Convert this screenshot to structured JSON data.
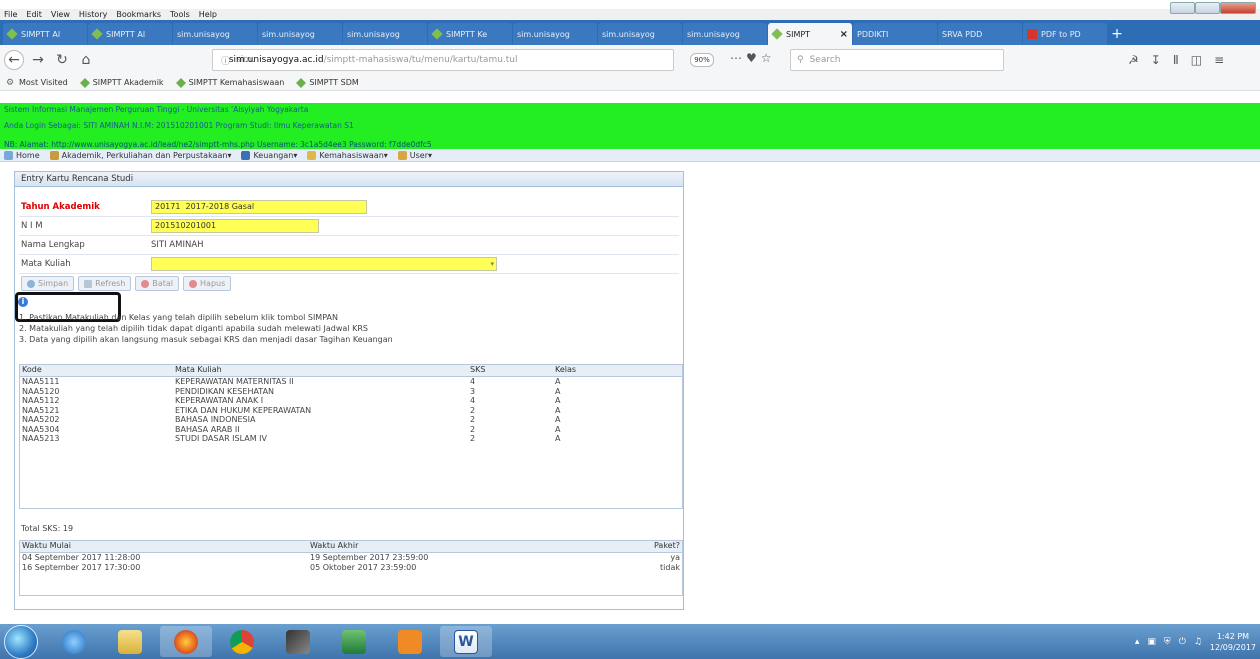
{
  "menubar": [
    "File",
    "Edit",
    "View",
    "History",
    "Bookmarks",
    "Tools",
    "Help"
  ],
  "tabs": [
    {
      "label": "SIMPTT Al",
      "icon": "diamond-icon",
      "active": false
    },
    {
      "label": "SIMPTT Al",
      "icon": "diamond-icon",
      "active": false
    },
    {
      "label": "sim.unisayog",
      "icon": "",
      "active": false
    },
    {
      "label": "sim.unisayog",
      "icon": "",
      "active": false
    },
    {
      "label": "sim.unisayog",
      "icon": "",
      "active": false
    },
    {
      "label": "SIMPTT Ke",
      "icon": "diamond-icon",
      "active": false
    },
    {
      "label": "sim.unisayog",
      "icon": "",
      "active": false
    },
    {
      "label": "sim.unisayog",
      "icon": "",
      "active": false
    },
    {
      "label": "sim.unisayog",
      "icon": "",
      "active": false
    },
    {
      "label": "SIMPT",
      "icon": "diamond-icon",
      "active": true
    },
    {
      "label": "PDDIKTI",
      "icon": "",
      "active": false
    },
    {
      "label": "SRVA PDD",
      "icon": "",
      "active": false
    },
    {
      "label": "PDF to PD",
      "icon": "pdf-icon",
      "active": false
    }
  ],
  "nav": {
    "url_domain": "sim.unisayogya.ac.id",
    "url_rest": "/simptt-mahasiswa/tu/menu/kartu/tamu.tul",
    "url_prefix": "sim.",
    "zoom": "90%",
    "search_placeholder": "Search"
  },
  "bookmarks": [
    {
      "label": "Most Visited"
    },
    {
      "label": "SIMPTT Akademik"
    },
    {
      "label": "SIMPTT Kemahasiswaan"
    },
    {
      "label": "SIMPTT SDM"
    }
  ],
  "green_header": {
    "line1": "Sistem Informasi Manajemen Perguruan Tinggi - Universitas 'Aisyiyah Yogyakarta",
    "line2": "Anda Login Sebagai: SITI AMINAH   N.I.M: 201510201001   Program Studi: Ilmu Keperawatan S1",
    "line3": "NB:   Alamat: http://www.unisayogya.ac.id/lead/ne2/simptt-mhs.php    Username: 3c1a5d4ee3   Password: f7dde0dfc5"
  },
  "app_menu": [
    {
      "label": "Home"
    },
    {
      "label": "Akademik, Perkuliahan dan Perpustakaan"
    },
    {
      "label": "Keuangan"
    },
    {
      "label": "Kemahasiswaan"
    },
    {
      "label": "User"
    }
  ],
  "panel": {
    "title": "Entry Kartu Rencana Studi",
    "tahun_label": "Tahun Akademik",
    "tahun_code": "20171",
    "tahun_name": "2017-2018 Gasal",
    "nim_label": "N I M",
    "nim_value": "201510201001",
    "nama_label": "Nama Lengkap",
    "nama_value": "SITI AMINAH",
    "matkul_label": "Mata Kuliah",
    "matkul_value": ""
  },
  "buttons": {
    "simpan": "Simpan",
    "refresh": "Refresh",
    "batal": "Batal",
    "hapus": "Hapus"
  },
  "notes": [
    "1. Pastikan Matakuliah dan Kelas yang telah dipilih sebelum klik tombol SIMPAN",
    "2. Matakuliah yang telah dipilih tidak dapat diganti apabila sudah melewati Jadwal KRS",
    "3. Data yang dipilih akan langsung masuk sebagai KRS dan menjadi dasar Tagihan Keuangan"
  ],
  "course_table": {
    "headers": [
      "Kode",
      "Mata Kuliah",
      "SKS",
      "Kelas"
    ],
    "rows": [
      [
        "NAA5111",
        "KEPERAWATAN MATERNITAS II",
        "4",
        "A"
      ],
      [
        "NAA5120",
        "PENDIDIKAN KESEHATAN",
        "3",
        "A"
      ],
      [
        "NAA5112",
        "KEPERAWATAN ANAK I",
        "4",
        "A"
      ],
      [
        "NAA5121",
        "ETIKA DAN HUKUM KEPERAWATAN",
        "2",
        "A"
      ],
      [
        "NAA5202",
        "BAHASA INDONESIA",
        "2",
        "A"
      ],
      [
        "NAA5304",
        "BAHASA ARAB II",
        "2",
        "A"
      ],
      [
        "NAA5213",
        "STUDI DASAR ISLAM IV",
        "2",
        "A"
      ]
    ]
  },
  "total_sks": "Total SKS: 19",
  "period_table": {
    "headers": [
      "Waktu Mulai",
      "Waktu Akhir",
      "Paket?"
    ],
    "rows": [
      [
        "04 September 2017 11:28:00",
        "19 September 2017 23:59:00",
        "ya"
      ],
      [
        "16 September 2017 17:30:00",
        "05 Oktober 2017 23:59:00",
        "tidak"
      ]
    ]
  },
  "taskbar": {
    "time": "1:42 PM",
    "date": "12/09/2017"
  },
  "colors": {
    "tab_bar": "#2d6db6",
    "green_header": "#22ee22",
    "yellow_field": "#ffff55",
    "label_red": "#dd0000"
  }
}
